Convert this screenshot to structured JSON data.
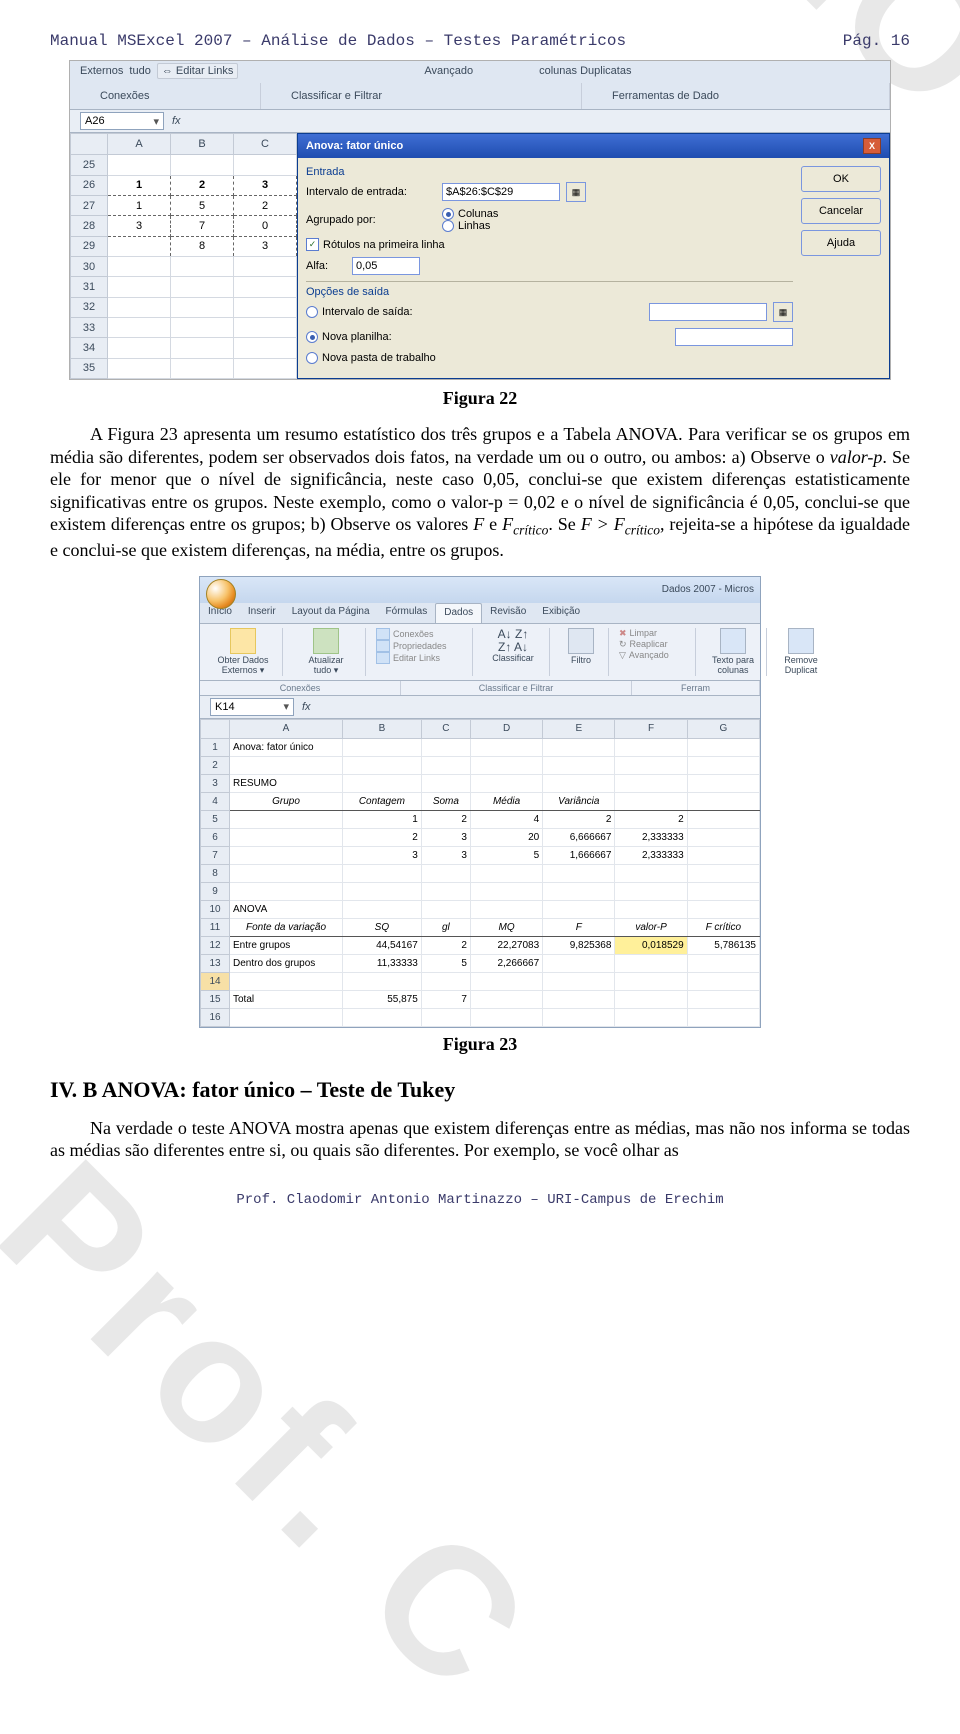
{
  "header": {
    "left": "Manual MSExcel 2007 – Análise de Dados – Testes Paramétricos",
    "right": "Pág.   16"
  },
  "figure22": {
    "caption": "Figura 22",
    "ribbon_groups": [
      "Externos",
      "tudo",
      "Conexões",
      "Classificar e Filtrar",
      "Ferramentas de Dado"
    ],
    "name_box": "A26",
    "fx": "fx",
    "col_headers": [
      "A",
      "B",
      "C"
    ],
    "row_headers": [
      "25",
      "26",
      "27",
      "28",
      "29",
      "30",
      "31",
      "32",
      "33",
      "34",
      "35"
    ],
    "cells": [
      [
        "",
        "",
        ""
      ],
      [
        "1",
        "2",
        "3"
      ],
      [
        "1",
        "5",
        "2"
      ],
      [
        "3",
        "7",
        "0"
      ],
      [
        "",
        "8",
        "3"
      ],
      [
        "",
        "",
        ""
      ],
      [
        "",
        "",
        ""
      ],
      [
        "",
        "",
        ""
      ],
      [
        "",
        "",
        ""
      ],
      [
        "",
        "",
        ""
      ],
      [
        "",
        "",
        ""
      ]
    ],
    "dialog": {
      "title": "Anova: fator único",
      "entrada_label": "Entrada",
      "intervalo_label": "Intervalo de entrada:",
      "intervalo_value": "$A$26:$C$29",
      "agrupado_label": "Agrupado por:",
      "colunas": "Colunas",
      "linhas": "Linhas",
      "rotulos": "Rótulos na primeira linha",
      "alfa_label": "Alfa:",
      "alfa_value": "0,05",
      "opcoes_label": "Opções de saída",
      "opt1": "Intervalo de saída:",
      "opt2": "Nova planilha:",
      "opt3": "Nova pasta de trabalho",
      "ok": "OK",
      "cancel": "Cancelar",
      "help": "Ajuda"
    }
  },
  "body1": "A Figura 23 apresenta um resumo estatístico dos três grupos e a Tabela ANOVA. Para verificar se os grupos em média são diferentes, podem ser observados dois fatos, na verdade um ou o outro, ou ambos: a) Observe o ",
  "body1_valorp": "valor-p",
  "body1b": ". Se ele for menor que o nível de significância, neste caso 0,05, conclui-se que existem diferenças estatisticamente significativas entre os grupos. Neste exemplo, como o valor-p = 0,02 e o nível de significância é 0,05, conclui-se que existem diferenças entre os grupos; b) Observe os valores ",
  "body1_F1": "F",
  "body1_e": " e ",
  "body1_Fcrit1": "Fcrítico",
  "body1c": ". Se ",
  "body1_F2": "F > Fcrítico",
  "body1d": ", rejeita-se a hipótese da igualdade e conclui-se que existem diferenças, na média, entre os grupos.",
  "figure23": {
    "caption": "Figura 23",
    "titlebar": "Dados 2007 - Micros",
    "tabs": [
      "Início",
      "Inserir",
      "Layout da Página",
      "Fórmulas",
      "Dados",
      "Revisão",
      "Exibição"
    ],
    "active_tab": 4,
    "ribbon": {
      "obter": {
        "label1": "Obter Dados",
        "label2": "Externos"
      },
      "atualizar": {
        "label1": "Atualizar",
        "label2": "tudo"
      },
      "conexoes_items": [
        "Conexões",
        "Propriedades",
        "Editar Links"
      ],
      "sort_label": "Classificar",
      "filter_label": "Filtro",
      "avancado": "Avançado",
      "limpar": "Limpar",
      "reaplicar": "Reaplicar",
      "texto": {
        "label1": "Texto para",
        "label2": "colunas"
      },
      "remover": {
        "label1": "Remove",
        "label2": "Duplicat"
      }
    },
    "group_labels": [
      "Conexões",
      "Classificar e Filtrar",
      "Ferram"
    ],
    "name_box": "K14",
    "fx": "fx",
    "col_headers": [
      "A",
      "B",
      "C",
      "D",
      "E",
      "F",
      "G"
    ],
    "rows": [
      {
        "n": "1",
        "c": [
          "Anova: fator único",
          "",
          "",
          "",
          "",
          "",
          ""
        ],
        "la": true
      },
      {
        "n": "2",
        "c": [
          "",
          "",
          "",
          "",
          "",
          "",
          ""
        ]
      },
      {
        "n": "3",
        "c": [
          "RESUMO",
          "",
          "",
          "",
          "",
          "",
          ""
        ],
        "la": true
      },
      {
        "n": "4",
        "c": [
          "Grupo",
          "Contagem",
          "Soma",
          "Média",
          "Variância",
          "",
          ""
        ],
        "it": true,
        "c0c": true
      },
      {
        "n": "5",
        "c": [
          "",
          "1",
          "2",
          "4",
          "2",
          "2",
          ""
        ]
      },
      {
        "n": "6",
        "c": [
          "",
          "2",
          "3",
          "20",
          "6,666667",
          "2,333333",
          ""
        ]
      },
      {
        "n": "7",
        "c": [
          "",
          "3",
          "3",
          "5",
          "1,666667",
          "2,333333",
          ""
        ]
      },
      {
        "n": "8",
        "c": [
          "",
          "",
          "",
          "",
          "",
          "",
          ""
        ]
      },
      {
        "n": "9",
        "c": [
          "",
          "",
          "",
          "",
          "",
          "",
          ""
        ]
      },
      {
        "n": "10",
        "c": [
          "ANOVA",
          "",
          "",
          "",
          "",
          "",
          ""
        ],
        "la": true
      },
      {
        "n": "11",
        "c": [
          "Fonte da variação",
          "SQ",
          "gl",
          "MQ",
          "F",
          "valor-P",
          "F crítico"
        ],
        "it": true,
        "la0": true
      },
      {
        "n": "12",
        "c": [
          "Entre grupos",
          "44,54167",
          "2",
          "22,27083",
          "9,825368",
          "0,018529",
          "5,786135"
        ],
        "la0": true,
        "hl": 5
      },
      {
        "n": "13",
        "c": [
          "Dentro dos grupos",
          "11,33333",
          "5",
          "2,266667",
          "",
          "",
          ""
        ],
        "la0": true
      },
      {
        "n": "14",
        "c": [
          "",
          "",
          "",
          "",
          "",
          "",
          ""
        ],
        "sel": true
      },
      {
        "n": "15",
        "c": [
          "Total",
          "55,875",
          "7",
          "",
          "",
          "",
          ""
        ],
        "la0": true
      },
      {
        "n": "16",
        "c": [
          "",
          "",
          "",
          "",
          "",
          "",
          ""
        ]
      }
    ]
  },
  "section_title": "IV. B ANOVA: fator único – Teste de Tukey",
  "body2": "Na verdade o teste ANOVA mostra apenas que existem diferenças entre as médias, mas não nos informa se todas as médias são diferentes entre si, ou quais são diferentes. Por exemplo, se você olhar as",
  "footer": "Prof. Claodomir Antonio Martinazzo – URI-Campus de Erechim"
}
